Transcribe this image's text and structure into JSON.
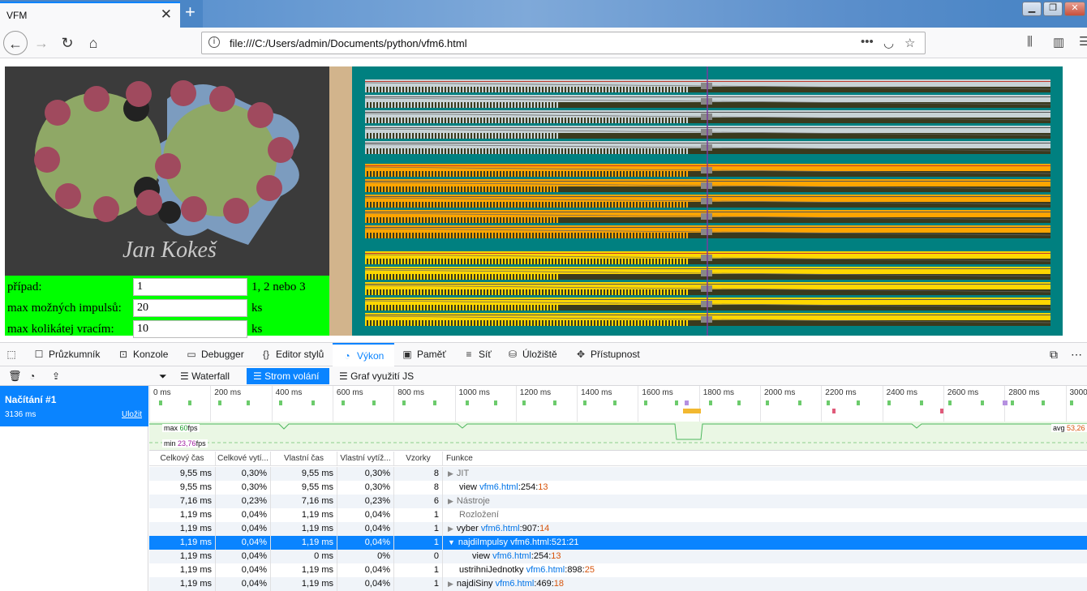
{
  "browser": {
    "tab_title": "VFM",
    "url": "file:///C:/Users/admin/Documents/python/vfm6.html"
  },
  "page": {
    "signature": "Jan Kokeš",
    "form": [
      {
        "label": "případ:",
        "value": "1",
        "hint": "1, 2 nebo 3"
      },
      {
        "label": "max možných impulsů:",
        "value": "20",
        "hint": "ks"
      },
      {
        "label": "max kolikátej vracím:",
        "value": "10",
        "hint": "ks"
      }
    ]
  },
  "devtools": {
    "tabs": [
      {
        "icon": "inspector-icon",
        "label": "Průzkumník"
      },
      {
        "icon": "console-icon",
        "label": "Konzole"
      },
      {
        "icon": "debugger-icon",
        "label": "Debugger"
      },
      {
        "icon": "style-editor-icon",
        "label": "Editor stylů"
      },
      {
        "icon": "performance-icon",
        "label": "Výkon"
      },
      {
        "icon": "memory-icon",
        "label": "Paměť"
      },
      {
        "icon": "network-icon",
        "label": "Síť"
      },
      {
        "icon": "storage-icon",
        "label": "Úložiště"
      },
      {
        "icon": "accessibility-icon",
        "label": "Přístupnost"
      }
    ],
    "selected_tab": "Výkon",
    "subtabs": [
      "Waterfall",
      "Strom volání",
      "Graf využití JS"
    ],
    "selected_subtab": "Strom volání",
    "recording": {
      "name": "Načítání #1",
      "duration": "3136 ms",
      "save_label": "Uložit"
    },
    "timeline": {
      "ticks": [
        "0 ms",
        "200 ms",
        "400 ms",
        "600 ms",
        "800 ms",
        "1000 ms",
        "1200 ms",
        "1400 ms",
        "1600 ms",
        "1800 ms",
        "2000 ms",
        "2200 ms",
        "2400 ms",
        "2600 ms",
        "2800 ms",
        "3000"
      ],
      "fps_max_label": "max",
      "fps_max": "60",
      "fps_min_label": "min",
      "fps_min": "23,76",
      "fps_unit": "fps",
      "fps_avg_label": "avg",
      "fps_avg": "53,26"
    },
    "columns": [
      "Celkový čas",
      "Celkové vytí...",
      "Vlastní čas",
      "Vlastní vytíž...",
      "Vzorky",
      "Funkce"
    ],
    "rows": [
      {
        "total": "9,55 ms",
        "total_pct": "0,30%",
        "self": "9,55 ms",
        "self_pct": "0,30%",
        "samples": "8",
        "twisty": "▶",
        "indent": 0,
        "name": "JIT",
        "file": "",
        "line": "",
        "col": "",
        "gray": true
      },
      {
        "total": "9,55 ms",
        "total_pct": "0,30%",
        "self": "9,55 ms",
        "self_pct": "0,30%",
        "samples": "8",
        "twisty": "",
        "indent": 0,
        "name": "view",
        "file": "vfm6.html",
        "line": "254",
        "col": "13"
      },
      {
        "total": "7,16 ms",
        "total_pct": "0,23%",
        "self": "7,16 ms",
        "self_pct": "0,23%",
        "samples": "6",
        "twisty": "▶",
        "indent": 0,
        "name": "Nástroje",
        "file": "",
        "line": "",
        "col": "",
        "gray": true
      },
      {
        "total": "1,19 ms",
        "total_pct": "0,04%",
        "self": "1,19 ms",
        "self_pct": "0,04%",
        "samples": "1",
        "twisty": "",
        "indent": 0,
        "name": "Rozložení",
        "file": "",
        "line": "",
        "col": "",
        "gray": true
      },
      {
        "total": "1,19 ms",
        "total_pct": "0,04%",
        "self": "1,19 ms",
        "self_pct": "0,04%",
        "samples": "1",
        "twisty": "▶",
        "indent": 0,
        "name": "vyber",
        "file": "vfm6.html",
        "line": "907",
        "col": "14"
      },
      {
        "total": "1,19 ms",
        "total_pct": "0,04%",
        "self": "1,19 ms",
        "self_pct": "0,04%",
        "samples": "1",
        "twisty": "▼",
        "indent": 0,
        "name": "najdiImpulsy",
        "file": "vfm6.html",
        "line": "521",
        "col": "21",
        "selected": true
      },
      {
        "total": "1,19 ms",
        "total_pct": "0,04%",
        "self": "0 ms",
        "self_pct": "0%",
        "samples": "0",
        "twisty": "",
        "indent": 1,
        "name": "view",
        "file": "vfm6.html",
        "line": "254",
        "col": "13"
      },
      {
        "total": "1,19 ms",
        "total_pct": "0,04%",
        "self": "1,19 ms",
        "self_pct": "0,04%",
        "samples": "1",
        "twisty": "",
        "indent": 0,
        "name": "ustrihniJednotky",
        "file": "vfm6.html",
        "line": "898",
        "col": "25"
      },
      {
        "total": "1,19 ms",
        "total_pct": "0,04%",
        "self": "1,19 ms",
        "self_pct": "0,04%",
        "samples": "1",
        "twisty": "▶",
        "indent": 0,
        "name": "najdiSiny",
        "file": "vfm6.html",
        "line": "469",
        "col": "18"
      }
    ]
  },
  "colors": {
    "accent": "#0a84ff",
    "form_bg": "#00ff00",
    "canvas_teal": "#008080",
    "band_orange": "#ffa500",
    "band_yellow": "#ffd700"
  }
}
